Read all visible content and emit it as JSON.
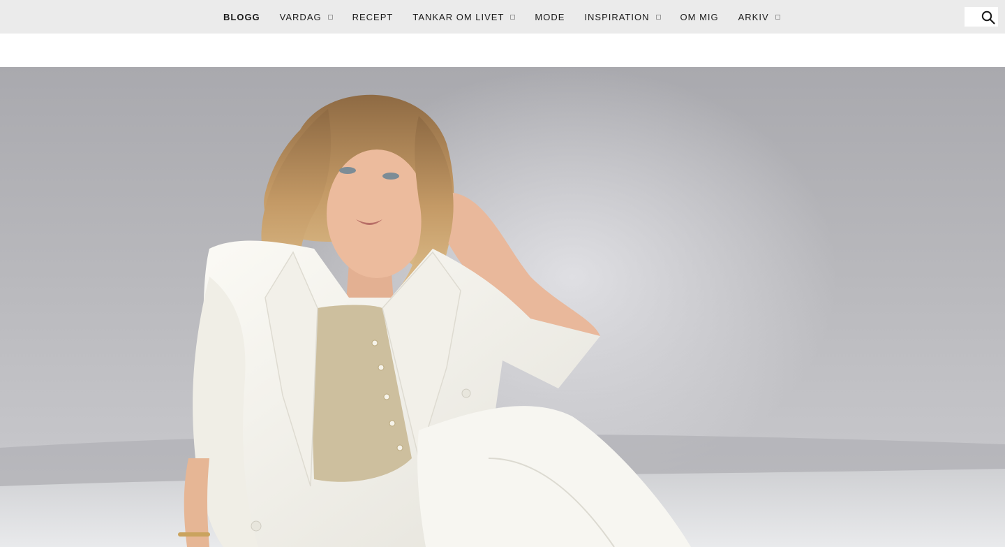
{
  "nav": {
    "items": [
      {
        "label": "BLOGG",
        "dropdown": false,
        "active": true
      },
      {
        "label": "VARDAG",
        "dropdown": true,
        "active": false
      },
      {
        "label": "RECEPT",
        "dropdown": false,
        "active": false
      },
      {
        "label": "TANKAR OM LIVET",
        "dropdown": true,
        "active": false
      },
      {
        "label": "MODE",
        "dropdown": false,
        "active": false
      },
      {
        "label": "INSPIRATION",
        "dropdown": true,
        "active": false
      },
      {
        "label": "OM MIG",
        "dropdown": false,
        "active": false
      },
      {
        "label": "ARKIV",
        "dropdown": true,
        "active": false
      }
    ]
  },
  "search": {
    "icon": "search-icon"
  },
  "hero": {
    "subject": "woman-in-white-suit-photo",
    "colors": {
      "backdrop": "#b4b4b8",
      "suit": "#f4f2ec",
      "blouse": "#cbbf9f",
      "hair": "#b98f5c",
      "skin": "#e8b79a"
    }
  },
  "colors": {
    "topbar": "#ebebeb",
    "text": "#1a1a1a"
  }
}
